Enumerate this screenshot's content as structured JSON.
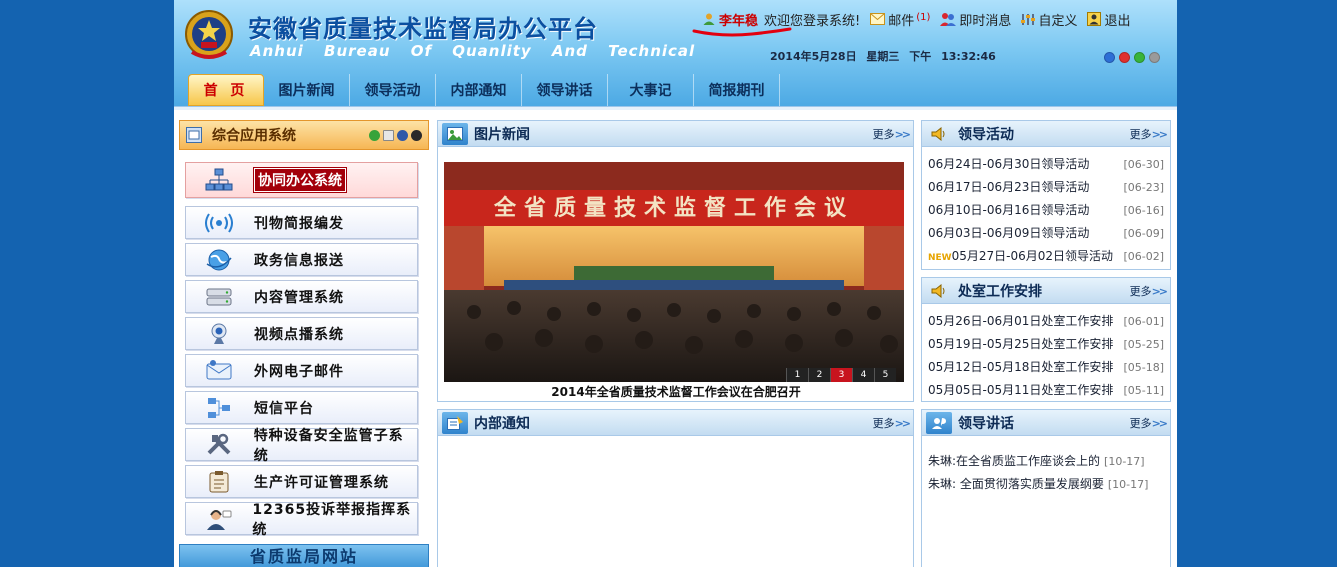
{
  "header": {
    "title": "安徽省质量技术监督局办公平台",
    "subtitle": "Anhui Bureau Of Quanlity And Technical",
    "user_name": "李年稳",
    "welcome": "欢迎您登录系统!",
    "mail_label": "邮件",
    "mail_count": "(1)",
    "im_label": "即时消息",
    "custom_label": "自定义",
    "logout_label": "退出",
    "date": "2014年5月28日",
    "weekday": "星期三",
    "ampm": "下午",
    "time": "13:32:46"
  },
  "nav": {
    "items": [
      {
        "label": "首 页"
      },
      {
        "label": "图片新闻"
      },
      {
        "label": "领导活动"
      },
      {
        "label": "内部通知"
      },
      {
        "label": "领导讲话"
      },
      {
        "label": "大事记"
      },
      {
        "label": "简报期刊"
      }
    ]
  },
  "sidebar": {
    "title": "综合应用系统",
    "items": [
      {
        "label": "协同办公系统",
        "icon": "network-icon"
      },
      {
        "label": "刊物简报编发",
        "icon": "broadcast-icon"
      },
      {
        "label": "政务信息报送",
        "icon": "globe-icon"
      },
      {
        "label": "内容管理系统",
        "icon": "server-icon"
      },
      {
        "label": "视频点播系统",
        "icon": "webcam-icon"
      },
      {
        "label": "外网电子邮件",
        "icon": "email-icon"
      },
      {
        "label": "短信平台",
        "icon": "sms-icon"
      },
      {
        "label": "特种设备安全监管子系统",
        "icon": "tools-icon"
      },
      {
        "label": "生产许可证管理系统",
        "icon": "clipboard-icon"
      },
      {
        "label": "12365投诉举报指挥系统",
        "icon": "operator-icon"
      }
    ],
    "footer": "省质监局网站"
  },
  "more_label": "更多",
  "photo_news": {
    "title": "图片新闻",
    "banner": "全省质量技术监督工作会议",
    "caption": "2014年全省质量技术监督工作会议在合肥召开",
    "pages": [
      "1",
      "2",
      "3",
      "4",
      "5"
    ],
    "active_page": "3"
  },
  "internal_notice": {
    "title": "内部通知"
  },
  "leader_activity": {
    "title": "领导活动",
    "items": [
      {
        "text": "06月24日-06月30日领导活动",
        "date": "[06-30]"
      },
      {
        "text": "06月17日-06月23日领导活动",
        "date": "[06-23]"
      },
      {
        "text": "06月10日-06月16日领导活动",
        "date": "[06-16]"
      },
      {
        "text": "06月03日-06月09日领导活动",
        "date": "[06-09]"
      },
      {
        "text": "05月27日-06月02日领导活动",
        "date": "[06-02]",
        "new": "NEW"
      }
    ]
  },
  "office_schedule": {
    "title": "处室工作安排",
    "items": [
      {
        "text": "05月26日-06月01日处室工作安排",
        "date": "[06-01]"
      },
      {
        "text": "05月19日-05月25日处室工作安排",
        "date": "[05-25]"
      },
      {
        "text": "05月12日-05月18日处室工作安排",
        "date": "[05-18]"
      },
      {
        "text": "05月05日-05月11日处室工作安排",
        "date": "[05-11]"
      }
    ]
  },
  "leader_speech": {
    "title": "领导讲话",
    "items": [
      {
        "text": "朱琳:在全省质监工作座谈会上的",
        "date": "[10-17]"
      },
      {
        "text": "朱琳: 全面贯彻落实质量发展纲要",
        "date": "[10-17]"
      }
    ]
  },
  "colors": {
    "background": "#1463b0",
    "accent_red": "#c00000",
    "header_blue": "#49a7e3"
  }
}
